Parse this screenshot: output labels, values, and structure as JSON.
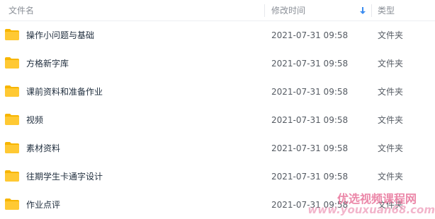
{
  "columns": {
    "name": "文件名",
    "modified": "修改时间",
    "type": "类型"
  },
  "files": [
    {
      "name": "操作小问题与基础",
      "modified": "2021-07-31 09:58",
      "type": "文件夹"
    },
    {
      "name": "方格新字库",
      "modified": "2021-07-31 09:58",
      "type": "文件夹"
    },
    {
      "name": "课前资料和准备作业",
      "modified": "2021-07-31 09:58",
      "type": "文件夹"
    },
    {
      "name": "视频",
      "modified": "2021-07-31 09:58",
      "type": "文件夹"
    },
    {
      "name": "素材资料",
      "modified": "2021-07-31 09:58",
      "type": "文件夹"
    },
    {
      "name": "往期学生卡通字设计",
      "modified": "2021-07-31 09:58",
      "type": "文件夹"
    },
    {
      "name": "作业点评",
      "modified": "2021-07-31 09:58",
      "type": "文件夹"
    }
  ],
  "watermark": {
    "line1": "优选视频课程网",
    "line2": "www.youxuan68.com"
  },
  "colors": {
    "folder": "#ffc933",
    "folder_tab": "#f7b500",
    "sort_arrow": "#3b8cf0"
  },
  "icons": {
    "folder": "folder-icon",
    "sort": "sort-descending-icon"
  }
}
